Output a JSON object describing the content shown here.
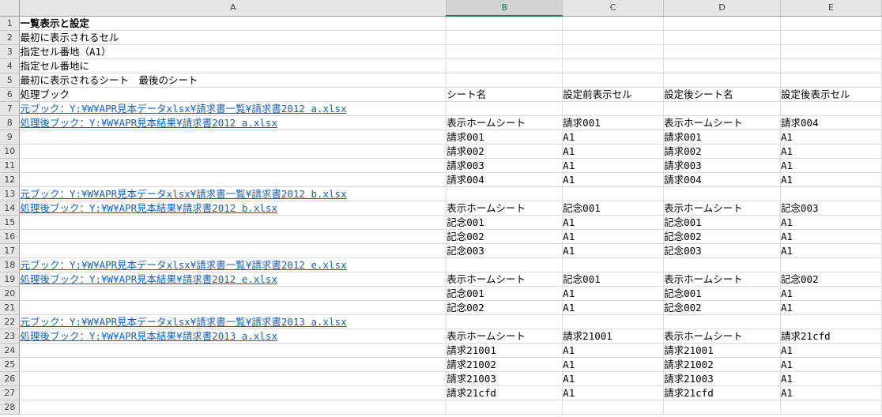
{
  "columns": [
    "A",
    "B",
    "C",
    "D",
    "E"
  ],
  "selected_column": "B",
  "rows": [
    {
      "num": "1",
      "A": "一覧表示と設定",
      "B": "",
      "C": "",
      "D": "",
      "E": ""
    },
    {
      "num": "2",
      "A": "最初に表示されるセル",
      "B": "",
      "C": "",
      "D": "",
      "E": ""
    },
    {
      "num": "3",
      "A": "指定セル番地（A1）",
      "B": "",
      "C": "",
      "D": "",
      "E": ""
    },
    {
      "num": "4",
      "A": "指定セル番地に",
      "B": "",
      "C": "",
      "D": "",
      "E": ""
    },
    {
      "num": "5",
      "A": "最初に表示されるシート　最後のシート",
      "B": "",
      "C": "",
      "D": "",
      "E": ""
    },
    {
      "num": "6",
      "A": "処理ブック",
      "B": "シート名",
      "C": "設定前表示セル",
      "D": "設定後シート名",
      "E": "設定後表示セル"
    },
    {
      "num": "7",
      "A": "元ブック：Y:¥W¥APR見本データxlsx¥請求書一覧¥請求書2012 a.xlsx",
      "B": "",
      "C": "",
      "D": "",
      "E": ""
    },
    {
      "num": "8",
      "A": "処理後ブック：Y:¥W¥APR見本結果¥請求書2012 a.xlsx",
      "B": "表示ホームシート",
      "C": "請求001",
      "D": "表示ホームシート",
      "E": "請求004"
    },
    {
      "num": "9",
      "A": "",
      "B": "請求001",
      "C": "A1",
      "D": "請求001",
      "E": "A1"
    },
    {
      "num": "10",
      "A": "",
      "B": "請求002",
      "C": "A1",
      "D": "請求002",
      "E": "A1"
    },
    {
      "num": "11",
      "A": "",
      "B": "請求003",
      "C": "A1",
      "D": "請求003",
      "E": "A1"
    },
    {
      "num": "12",
      "A": "",
      "B": "請求004",
      "C": "A1",
      "D": "請求004",
      "E": "A1"
    },
    {
      "num": "13",
      "A": "元ブック：Y:¥W¥APR見本データxlsx¥請求書一覧¥請求書2012 b.xlsx",
      "B": "",
      "C": "",
      "D": "",
      "E": ""
    },
    {
      "num": "14",
      "A": "処理後ブック：Y:¥W¥APR見本結果¥請求書2012 b.xlsx",
      "B": "表示ホームシート",
      "C": "記念001",
      "D": "表示ホームシート",
      "E": "記念003"
    },
    {
      "num": "15",
      "A": "",
      "B": "記念001",
      "C": "A1",
      "D": "記念001",
      "E": "A1"
    },
    {
      "num": "16",
      "A": "",
      "B": "記念002",
      "C": "A1",
      "D": "記念002",
      "E": "A1"
    },
    {
      "num": "17",
      "A": "",
      "B": "記念003",
      "C": "A1",
      "D": "記念003",
      "E": "A1"
    },
    {
      "num": "18",
      "A": "元ブック：Y:¥W¥APR見本データxlsx¥請求書一覧¥請求書2012 e.xlsx",
      "B": "",
      "C": "",
      "D": "",
      "E": ""
    },
    {
      "num": "19",
      "A": "処理後ブック：Y:¥W¥APR見本結果¥請求書2012 e.xlsx",
      "B": "表示ホームシート",
      "C": "記念001",
      "D": "表示ホームシート",
      "E": "記念002"
    },
    {
      "num": "20",
      "A": "",
      "B": "記念001",
      "C": "A1",
      "D": "記念001",
      "E": "A1"
    },
    {
      "num": "21",
      "A": "",
      "B": "記念002",
      "C": "A1",
      "D": "記念002",
      "E": "A1"
    },
    {
      "num": "22",
      "A": "元ブック：Y:¥W¥APR見本データxlsx¥請求書一覧¥請求書2013 a.xlsx",
      "B": "",
      "C": "",
      "D": "",
      "E": ""
    },
    {
      "num": "23",
      "A": "処理後ブック：Y:¥W¥APR見本結果¥請求書2013 a.xlsx",
      "B": "表示ホームシート",
      "C": "請求21001",
      "D": "表示ホームシート",
      "E": "請求21cfd"
    },
    {
      "num": "24",
      "A": "",
      "B": "請求21001",
      "C": "A1",
      "D": "請求21001",
      "E": "A1"
    },
    {
      "num": "25",
      "A": "",
      "B": "請求21002",
      "C": "A1",
      "D": "請求21002",
      "E": "A1"
    },
    {
      "num": "26",
      "A": "",
      "B": "請求21003",
      "C": "A1",
      "D": "請求21003",
      "E": "A1"
    },
    {
      "num": "27",
      "A": "",
      "B": "請求21cfd",
      "C": "A1",
      "D": "請求21cfd",
      "E": "A1"
    },
    {
      "num": "28",
      "A": "",
      "B": "",
      "C": "",
      "D": "",
      "E": ""
    }
  ],
  "bold_rows": [
    "1"
  ],
  "link_rows": [
    "7",
    "8",
    "13",
    "14",
    "18",
    "19",
    "22",
    "23"
  ],
  "colors": {
    "link": "#1f5fa6",
    "header_bg": "#e6e6e6",
    "selected_header_accent": "#217346"
  }
}
